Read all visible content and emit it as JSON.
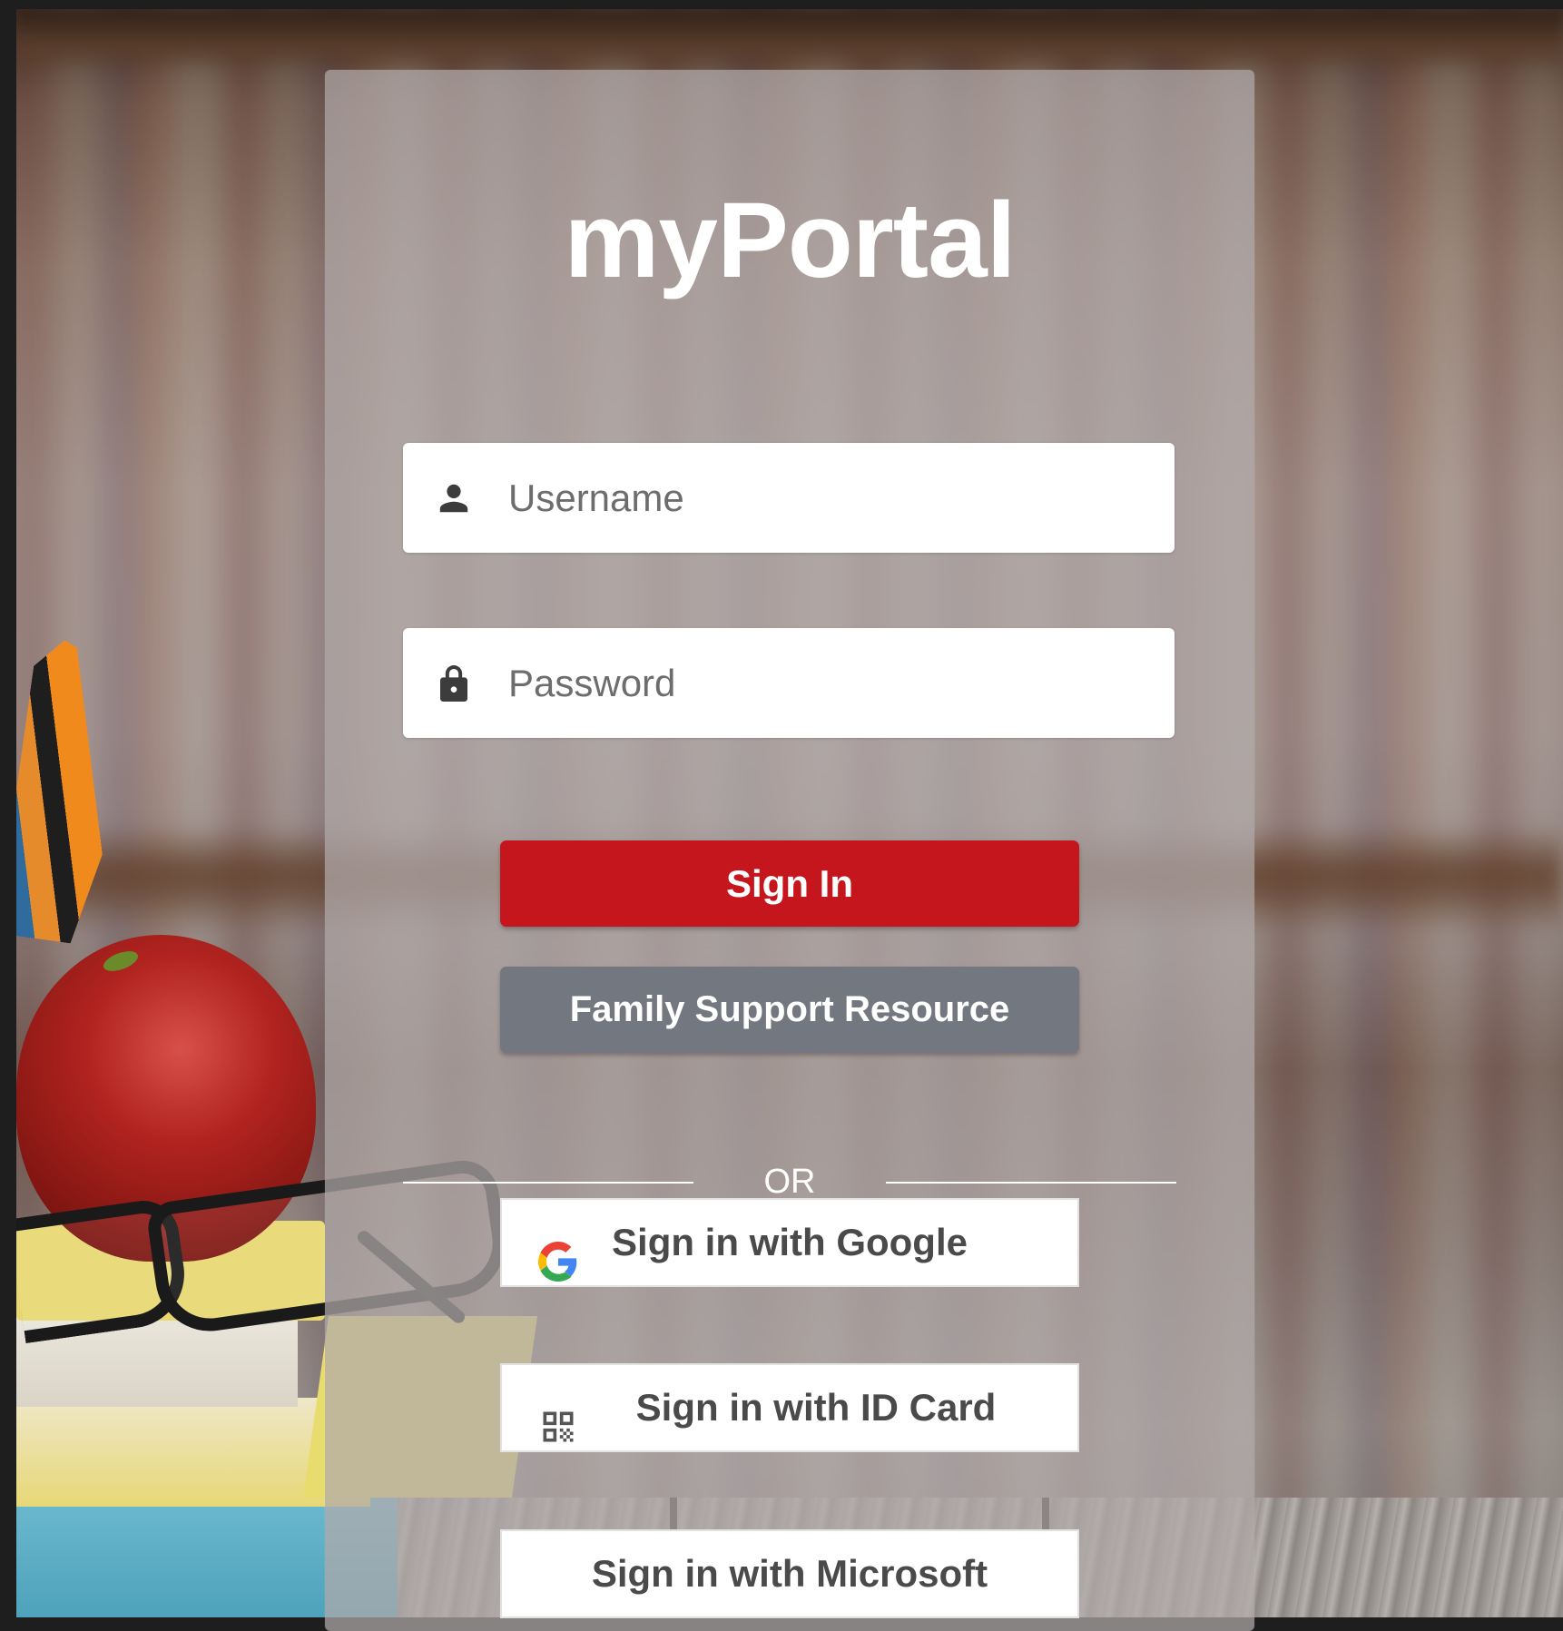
{
  "app": {
    "title": "myPortal"
  },
  "login": {
    "username_placeholder": "Username",
    "password_placeholder": "Password",
    "signin_label": "Sign In",
    "family_support_label": "Family Support Resource",
    "or_label": "OR",
    "google_label": "Sign in with Google",
    "idcard_label": "Sign in with ID Card",
    "microsoft_label": "Sign in with Microsoft"
  },
  "icons": {
    "username": "person-icon",
    "password": "lock-icon",
    "google": "google-logo-icon",
    "idcard": "qr-code-icon"
  },
  "colors": {
    "signin_button": "#c4161c",
    "family_button": "#737780",
    "panel": "rgba(178,170,170,0.72)"
  }
}
